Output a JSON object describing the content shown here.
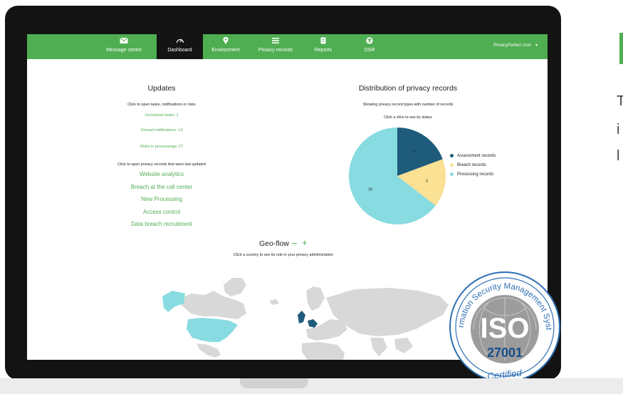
{
  "nav": {
    "items": [
      {
        "label": "Message centre",
        "icon": "envelope-icon"
      },
      {
        "label": "Dashboard",
        "icon": "gauge-icon",
        "active": true
      },
      {
        "label": "Environment",
        "icon": "map-pin-icon"
      },
      {
        "label": "Privacy records",
        "icon": "list-icon"
      },
      {
        "label": "Reports",
        "icon": "clipboard-icon"
      },
      {
        "label": "DSR",
        "icon": "person-badge-icon"
      }
    ],
    "user": "PrivacyPerfect User",
    "user_caret": "▾"
  },
  "updates": {
    "title": "Updates",
    "subtitle": "Click to open tasks, notifications or risks",
    "links": [
      "Unclaimed tasks: 1",
      "Unread notifications: 14",
      "Risks in processings: 27"
    ],
    "records_intro": "Click to open privacy records that were last updated",
    "records": [
      "Website analytics",
      "Breach at the call center",
      "New Processing",
      "Access control",
      "Data breach recruitment"
    ]
  },
  "distribution": {
    "title": "Distribution of privacy records",
    "subtitle": "Showing privacy record types with number of records",
    "hint": "Click a slice to see by status"
  },
  "chart_data": {
    "type": "pie",
    "slices": [
      {
        "label": "Assessment records",
        "value": 6,
        "color": "#1f5c7c"
      },
      {
        "label": "Breach records",
        "value": 5,
        "color": "#fae194"
      },
      {
        "label": "Processing records",
        "value": 20,
        "color": "#88dbe1"
      }
    ]
  },
  "geo": {
    "title": "Geo-flow",
    "minus": "–",
    "plus": "+",
    "subtitle": "Click a country to see its role in your privacy administration"
  },
  "badge": {
    "ring_text": "Information Security Management System",
    "iso": "ISO",
    "number": "27001",
    "certified": "Certified"
  },
  "side": {
    "line1": "T",
    "line2": "i",
    "line3": "l"
  },
  "colors": {
    "brand_green": "#4fae51",
    "nav_active": "#141414",
    "map_land": "#d8d8d8",
    "map_highlight_light": "#88dbe1",
    "map_highlight_dark": "#1f5c7c"
  }
}
